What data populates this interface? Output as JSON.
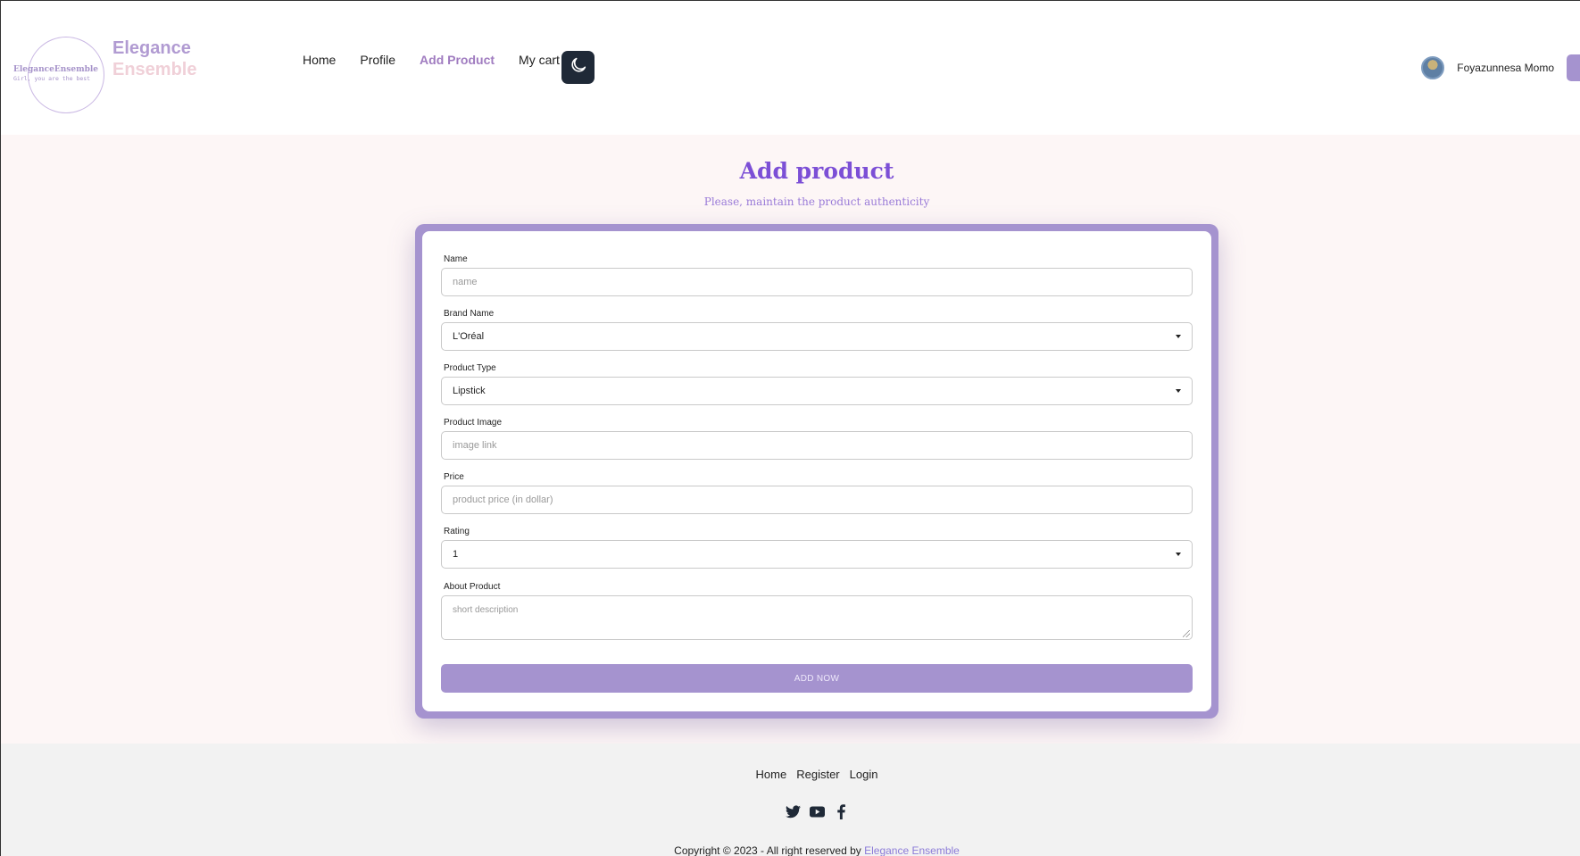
{
  "brand": {
    "circle_text": "EleganceEnsemble",
    "circle_subtext": "Girl, you are the best",
    "line1": "Elegance",
    "line2": "Ensemble"
  },
  "nav": {
    "items": [
      {
        "label": "Home",
        "active": false
      },
      {
        "label": "Profile",
        "active": false
      },
      {
        "label": "Add Product",
        "active": true
      },
      {
        "label": "My cart",
        "active": false
      }
    ],
    "theme_icon": "moon-icon"
  },
  "user": {
    "name": "Foyazunnesa Momo",
    "avatar_icon": "user-avatar"
  },
  "page": {
    "title": "Add product",
    "subtitle": "Please, maintain the product authenticity"
  },
  "form": {
    "name": {
      "label": "Name",
      "placeholder": "name"
    },
    "brand": {
      "label": "Brand Name",
      "value": "L'Oréal"
    },
    "type": {
      "label": "Product Type",
      "value": "Lipstick"
    },
    "image": {
      "label": "Product Image",
      "placeholder": "image link"
    },
    "price": {
      "label": "Price",
      "placeholder": "product price (in dollar)"
    },
    "rating": {
      "label": "Rating",
      "value": "1"
    },
    "about": {
      "label": "About Product",
      "placeholder": "short description"
    },
    "submit_label": "ADD NOW"
  },
  "footer": {
    "links": [
      "Home",
      "Register",
      "Login"
    ],
    "social_icons": [
      "twitter-icon",
      "youtube-icon",
      "facebook-icon"
    ],
    "copyright_text": "Copyright © 2023 - All right reserved by ",
    "copyright_brand": "Elegance Ensemble"
  },
  "colors": {
    "accent": "#a593cf",
    "title": "#7c4fd6",
    "active_nav": "#a07cc0",
    "main_bg": "#fdf6f6",
    "footer_bg": "#f2f2f2",
    "theme_button": "#1f2937"
  }
}
